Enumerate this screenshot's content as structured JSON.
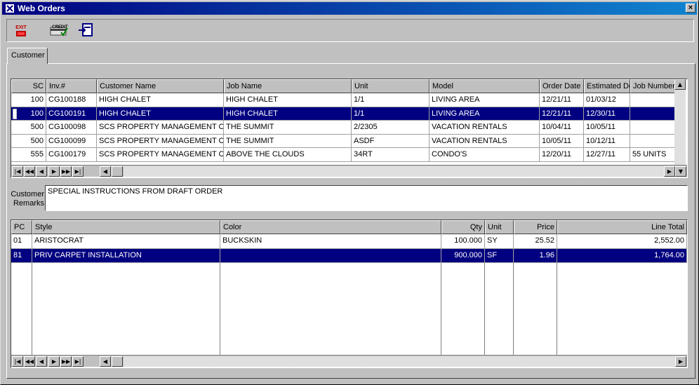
{
  "window": {
    "title": "Web Orders",
    "close_label": "×"
  },
  "toolbar": {
    "exit_label": "EXIT",
    "credit_label": "CREDIT"
  },
  "tabs": [
    {
      "label": "Customer"
    }
  ],
  "orders": {
    "columns": [
      "SC",
      "Inv.#",
      "Customer Name",
      "Job Name",
      "Unit",
      "Model",
      "Order Date",
      "Estimated De",
      "Job Number"
    ],
    "rows": [
      [
        "100",
        "CG100188",
        "HIGH CHALET",
        "HIGH CHALET",
        "1/1",
        "LIVING AREA",
        "12/21/11",
        "01/03/12",
        ""
      ],
      [
        "100",
        "CG100191",
        "HIGH CHALET",
        "HIGH CHALET",
        "1/1",
        "LIVING AREA",
        "12/21/11",
        "12/30/11",
        ""
      ],
      [
        "500",
        "CG100098",
        "SCS PROPERTY MANAGEMENT CO",
        "THE SUMMIT",
        "2/2305",
        "VACATION RENTALS",
        "10/04/11",
        "10/05/11",
        ""
      ],
      [
        "500",
        "CG100099",
        "SCS PROPERTY MANAGEMENT CO",
        "THE SUMMIT",
        "ASDF",
        "VACATION RENTALS",
        "10/05/11",
        "10/12/11",
        ""
      ],
      [
        "555",
        "CG100179",
        "SCS PROPERTY MANAGEMENT CO",
        "ABOVE THE CLOUDS",
        "34RT",
        "CONDO'S",
        "12/20/11",
        "12/27/11",
        "55 UNITS"
      ]
    ],
    "selected_row": 1
  },
  "remarks": {
    "label_line1": "Customer",
    "label_line2": "Remarks",
    "value": "SPECIAL INSTRUCTIONS FROM DRAFT ORDER"
  },
  "lines": {
    "columns": [
      "PC",
      "Style",
      "Color",
      "Qty",
      "Unit",
      "Price",
      "Line Total"
    ],
    "rows": [
      [
        "01",
        "ARISTOCRAT",
        "BUCKSKIN",
        "100.000",
        "SY",
        "25.52",
        "2,552.00"
      ],
      [
        "81",
        "PRIV CARPET INSTALLATION",
        "",
        "900.000",
        "SF",
        "1.96",
        "1,764.00"
      ]
    ],
    "selected_row": 1
  },
  "nav": {
    "first": "|◀",
    "prev_page": "◀◀",
    "prev": "◀",
    "next": "▶",
    "next_page": "▶▶",
    "last": "▶|"
  },
  "colors": {
    "selection": "#000080",
    "face": "#c0c0c0"
  }
}
